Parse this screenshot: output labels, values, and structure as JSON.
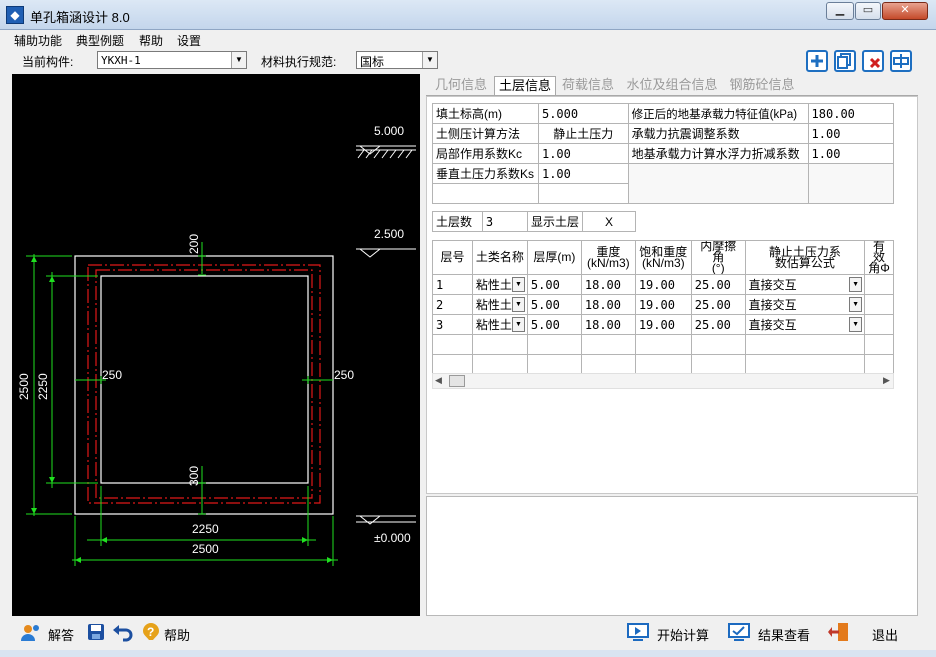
{
  "window": {
    "title": "单孔箱涵设计 8.0"
  },
  "menu": [
    "辅助功能",
    "典型例题",
    "帮助",
    "设置"
  ],
  "toolbar": {
    "component_label": "当前构件:",
    "component_value": "YKXH-1",
    "code_label": "材料执行规范:",
    "code_value": "国标"
  },
  "tabs": [
    "几何信息",
    "土层信息",
    "荷载信息",
    "水位及组合信息",
    "钢筋砼信息"
  ],
  "params": {
    "fill_elev_label": "填土标高(m)",
    "fill_elev_value": "5.000",
    "bearing_label": "修正后的地基承载力特征值(kPa)",
    "bearing_value": "180.00",
    "lateral_method_label": "土侧压计算方法",
    "lateral_method_value": "静止土压力",
    "seismic_label": "承载力抗震调整系数",
    "seismic_value": "1.00",
    "local_coef_label": "局部作用系数Kc",
    "local_coef_value": "1.00",
    "buoyancy_label": "地基承载力计算水浮力折减系数",
    "buoyancy_value": "1.00",
    "vertical_coef_label": "垂直土压力系数Ks",
    "vertical_coef_value": "1.00"
  },
  "layers_info": {
    "count_label": "土层数",
    "count_value": "3",
    "show_label": "显示土层",
    "show_value": "X"
  },
  "soil_table": {
    "headers": [
      "层号",
      "土类名称",
      "层厚(m)",
      "重度\n(kN/m3)",
      "饱和重度\n(kN/m3)",
      "内摩擦角\n(°)",
      "静止土压力系\n数估算公式",
      "有效\n角Φ"
    ],
    "rows": [
      [
        "1",
        "粘性土",
        "5.00",
        "18.00",
        "19.00",
        "25.00",
        "直接交互"
      ],
      [
        "2",
        "粘性土",
        "5.00",
        "18.00",
        "19.00",
        "25.00",
        "直接交互"
      ],
      [
        "3",
        "粘性土",
        "5.00",
        "18.00",
        "19.00",
        "25.00",
        "直接交互"
      ]
    ]
  },
  "drawing": {
    "elev_top": "5.000",
    "elev_mid": "2.500",
    "elev_bottom": "±0.000",
    "dim_top_wall": "200",
    "dim_bottom_wall": "300",
    "dim_left_wall": "250",
    "dim_right_wall": "250",
    "dim_inner_width": "2250",
    "dim_outer_width": "2500",
    "dim_inner_height": "2250",
    "dim_outer_height": "2500"
  },
  "bottom": {
    "answer": "解答",
    "help": "帮助",
    "start_calc": "开始计算",
    "view_results": "结果查看",
    "exit": "退出"
  }
}
